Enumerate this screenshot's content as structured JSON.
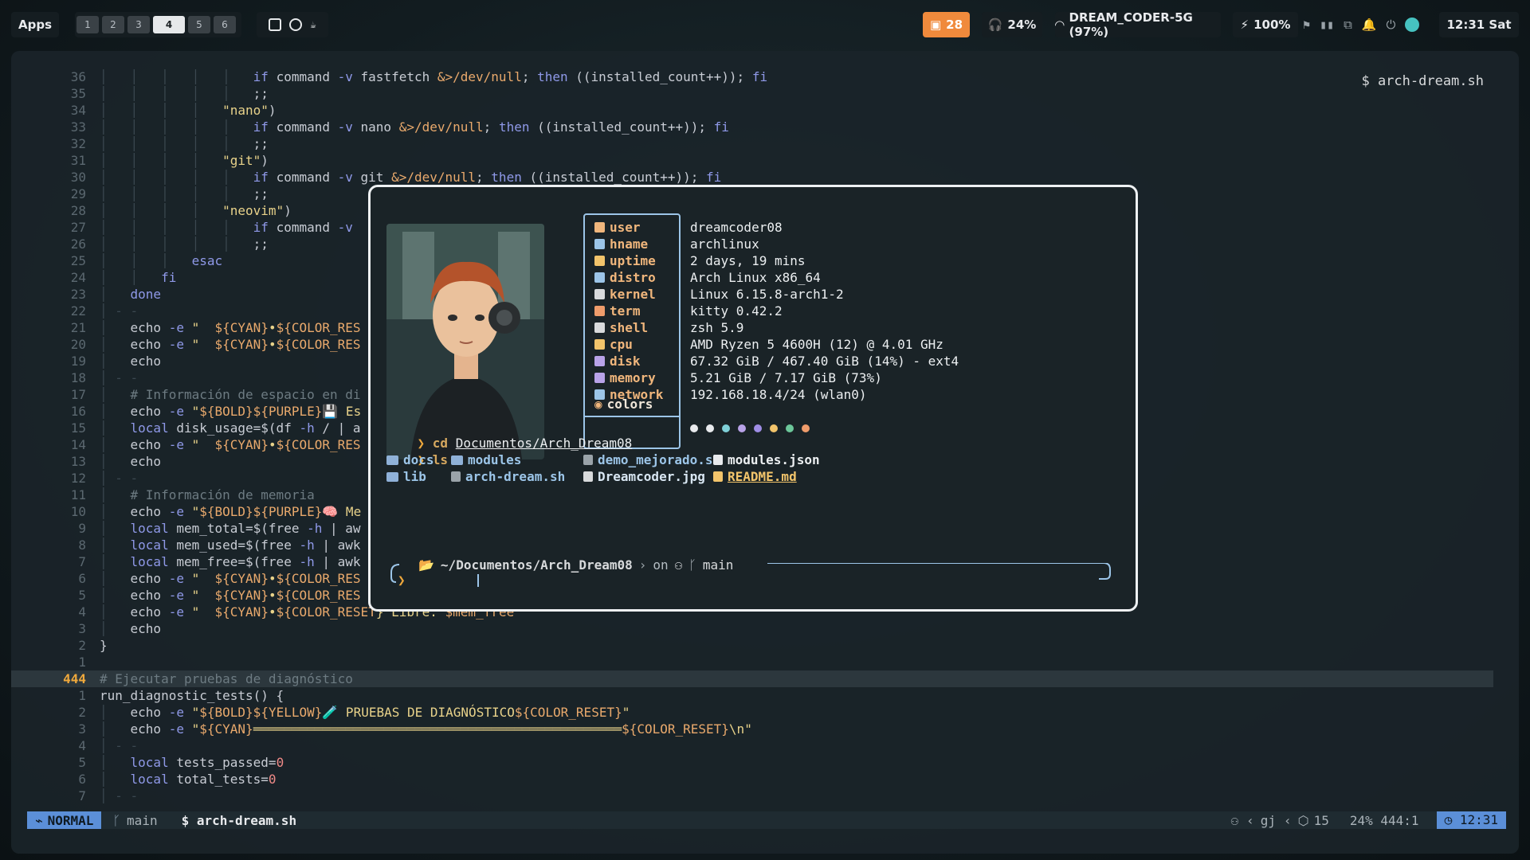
{
  "topbar": {
    "apps_label": "Apps",
    "workspaces": [
      "1",
      "2",
      "3",
      "4",
      "5",
      "6"
    ],
    "active_workspace": "4",
    "updates_count": "28",
    "audio": "24%",
    "wifi": "DREAM_CODER-5G (97%)",
    "battery": "100%",
    "clock": "12:31 Sat"
  },
  "editor": {
    "filename": "$ arch-dream.sh",
    "lines": [
      {
        "n": "36",
        "indent": "│   │   │   │   │   ",
        "parts": [
          [
            "kw",
            "if "
          ],
          [
            "cmd",
            "command "
          ],
          [
            "kw",
            "-v "
          ],
          [
            "cmd",
            "fastfetch "
          ],
          [
            "var",
            "&>/dev/null"
          ],
          [
            "cmd",
            "; "
          ],
          [
            "kw",
            "then "
          ],
          [
            "cmd",
            "((installed_count++)); "
          ],
          [
            "kw",
            "fi"
          ]
        ]
      },
      {
        "n": "35",
        "indent": "│   │   │   │   │   ",
        "parts": [
          [
            "cmd",
            ";;"
          ]
        ]
      },
      {
        "n": "34",
        "indent": "│   │   │   │   ",
        "parts": [
          [
            "str",
            "\"nano\""
          ],
          [
            "cmd",
            ")"
          ]
        ]
      },
      {
        "n": "33",
        "indent": "│   │   │   │   │   ",
        "parts": [
          [
            "kw",
            "if "
          ],
          [
            "cmd",
            "command "
          ],
          [
            "kw",
            "-v "
          ],
          [
            "cmd",
            "nano "
          ],
          [
            "var",
            "&>/dev/null"
          ],
          [
            "cmd",
            "; "
          ],
          [
            "kw",
            "then "
          ],
          [
            "cmd",
            "((installed_count++)); "
          ],
          [
            "kw",
            "fi"
          ]
        ]
      },
      {
        "n": "32",
        "indent": "│   │   │   │   │   ",
        "parts": [
          [
            "cmd",
            ";;"
          ]
        ]
      },
      {
        "n": "31",
        "indent": "│   │   │   │   ",
        "parts": [
          [
            "str",
            "\"git\""
          ],
          [
            "cmd",
            ")"
          ]
        ]
      },
      {
        "n": "30",
        "indent": "│   │   │   │   │   ",
        "parts": [
          [
            "kw",
            "if "
          ],
          [
            "cmd",
            "command "
          ],
          [
            "kw",
            "-v "
          ],
          [
            "cmd",
            "git "
          ],
          [
            "var",
            "&>/dev/null"
          ],
          [
            "cmd",
            "; "
          ],
          [
            "kw",
            "then "
          ],
          [
            "cmd",
            "((installed_count++)); "
          ],
          [
            "kw",
            "fi"
          ]
        ]
      },
      {
        "n": "29",
        "indent": "│   │   │   │   │   ",
        "parts": [
          [
            "cmd",
            ";;"
          ]
        ]
      },
      {
        "n": "28",
        "indent": "│   │   │   │   ",
        "parts": [
          [
            "str",
            "\"neovim\""
          ],
          [
            "cmd",
            ")"
          ]
        ]
      },
      {
        "n": "27",
        "indent": "│   │   │   │   │   ",
        "parts": [
          [
            "kw",
            "if "
          ],
          [
            "cmd",
            "command "
          ],
          [
            "kw",
            "-v"
          ]
        ]
      },
      {
        "n": "26",
        "indent": "│   │   │   │   │   ",
        "parts": [
          [
            "cmd",
            ";;"
          ]
        ]
      },
      {
        "n": "25",
        "indent": "│   │   │   ",
        "parts": [
          [
            "kw",
            "esac"
          ]
        ]
      },
      {
        "n": "24",
        "indent": "│   │   ",
        "parts": [
          [
            "kw",
            "fi"
          ]
        ]
      },
      {
        "n": "23",
        "indent": "│   ",
        "parts": [
          [
            "kw",
            "done"
          ]
        ]
      },
      {
        "n": "22",
        "indent": "│ - -",
        "parts": []
      },
      {
        "n": "21",
        "indent": "│   ",
        "parts": [
          [
            "cmd",
            "echo "
          ],
          [
            "kw",
            "-e "
          ],
          [
            "str",
            "\"  "
          ],
          [
            "var",
            "${CYAN}"
          ],
          [
            "str",
            "•"
          ],
          [
            "var",
            "${COLOR_RES"
          ]
        ]
      },
      {
        "n": "20",
        "indent": "│   ",
        "parts": [
          [
            "cmd",
            "echo "
          ],
          [
            "kw",
            "-e "
          ],
          [
            "str",
            "\"  "
          ],
          [
            "var",
            "${CYAN}"
          ],
          [
            "str",
            "•"
          ],
          [
            "var",
            "${COLOR_RES"
          ]
        ]
      },
      {
        "n": "19",
        "indent": "│   ",
        "parts": [
          [
            "cmd",
            "echo"
          ]
        ]
      },
      {
        "n": "18",
        "indent": "│ - -",
        "parts": []
      },
      {
        "n": "17",
        "indent": "│   ",
        "parts": [
          [
            "cmt",
            "# Información de espacio en di"
          ]
        ]
      },
      {
        "n": "16",
        "indent": "│   ",
        "parts": [
          [
            "cmd",
            "echo "
          ],
          [
            "kw",
            "-e "
          ],
          [
            "str",
            "\""
          ],
          [
            "var",
            "${BOLD}${PURPLE}"
          ],
          [
            "str",
            "💾 Es"
          ]
        ]
      },
      {
        "n": "15",
        "indent": "│   ",
        "parts": [
          [
            "kw",
            "local "
          ],
          [
            "cmd",
            "disk_usage=$(df "
          ],
          [
            "kw",
            "-h "
          ],
          [
            "cmd",
            "/ | a"
          ]
        ]
      },
      {
        "n": "14",
        "indent": "│   ",
        "parts": [
          [
            "cmd",
            "echo "
          ],
          [
            "kw",
            "-e "
          ],
          [
            "str",
            "\"  "
          ],
          [
            "var",
            "${CYAN}"
          ],
          [
            "str",
            "•"
          ],
          [
            "var",
            "${COLOR_RES"
          ]
        ]
      },
      {
        "n": "13",
        "indent": "│   ",
        "parts": [
          [
            "cmd",
            "echo"
          ]
        ]
      },
      {
        "n": "12",
        "indent": "│ - -",
        "parts": []
      },
      {
        "n": "11",
        "indent": "│   ",
        "parts": [
          [
            "cmt",
            "# Información de memoria"
          ]
        ]
      },
      {
        "n": "10",
        "indent": "│   ",
        "parts": [
          [
            "cmd",
            "echo "
          ],
          [
            "kw",
            "-e "
          ],
          [
            "str",
            "\""
          ],
          [
            "var",
            "${BOLD}${PURPLE}"
          ],
          [
            "str",
            "🧠 Me"
          ]
        ]
      },
      {
        "n": "9",
        "indent": "│   ",
        "parts": [
          [
            "kw",
            "local "
          ],
          [
            "cmd",
            "mem_total=$(free "
          ],
          [
            "kw",
            "-h "
          ],
          [
            "cmd",
            "| aw"
          ]
        ]
      },
      {
        "n": "8",
        "indent": "│   ",
        "parts": [
          [
            "kw",
            "local "
          ],
          [
            "cmd",
            "mem_used=$(free "
          ],
          [
            "kw",
            "-h "
          ],
          [
            "cmd",
            "| awk"
          ]
        ]
      },
      {
        "n": "7",
        "indent": "│   ",
        "parts": [
          [
            "kw",
            "local "
          ],
          [
            "cmd",
            "mem_free=$(free "
          ],
          [
            "kw",
            "-h "
          ],
          [
            "cmd",
            "| awk"
          ]
        ]
      },
      {
        "n": "6",
        "indent": "│   ",
        "parts": [
          [
            "cmd",
            "echo "
          ],
          [
            "kw",
            "-e "
          ],
          [
            "str",
            "\"  "
          ],
          [
            "var",
            "${CYAN}"
          ],
          [
            "str",
            "•"
          ],
          [
            "var",
            "${COLOR_RES"
          ]
        ]
      },
      {
        "n": "5",
        "indent": "│   ",
        "parts": [
          [
            "cmd",
            "echo "
          ],
          [
            "kw",
            "-e "
          ],
          [
            "str",
            "\"  "
          ],
          [
            "var",
            "${CYAN}"
          ],
          [
            "str",
            "•"
          ],
          [
            "var",
            "${COLOR_RES"
          ]
        ]
      },
      {
        "n": "4",
        "indent": "│   ",
        "parts": [
          [
            "cmd",
            "echo "
          ],
          [
            "kw",
            "-e "
          ],
          [
            "str",
            "\"  "
          ],
          [
            "var",
            "${CYAN}"
          ],
          [
            "str",
            "•"
          ],
          [
            "var",
            "${COLOR_RESET"
          ],
          [
            "str",
            "} Libre: "
          ],
          [
            "var",
            "$mem_free"
          ],
          [
            "str",
            "\""
          ]
        ]
      },
      {
        "n": "3",
        "indent": "│   ",
        "parts": [
          [
            "cmd",
            "echo"
          ]
        ]
      },
      {
        "n": "2",
        "indent": "",
        "parts": [
          [
            "cmd",
            "}"
          ]
        ]
      },
      {
        "n": "1",
        "indent": "",
        "parts": []
      },
      {
        "n": "444",
        "indent": "",
        "parts": [
          [
            "cmt",
            "# Ejecutar pruebas de diagnóstico"
          ]
        ],
        "current": true
      },
      {
        "n": "1",
        "indent": "",
        "parts": [
          [
            "cmd",
            "run_diagnostic_tests() {"
          ]
        ]
      },
      {
        "n": "2",
        "indent": "│   ",
        "parts": [
          [
            "cmd",
            "echo "
          ],
          [
            "kw",
            "-e "
          ],
          [
            "str",
            "\""
          ],
          [
            "var",
            "${BOLD}${YELLOW}"
          ],
          [
            "str",
            "🧪 PRUEBAS DE DIAGNÓSTICO"
          ],
          [
            "var",
            "${COLOR_RESET}"
          ],
          [
            "str",
            "\""
          ]
        ]
      },
      {
        "n": "3",
        "indent": "│   ",
        "parts": [
          [
            "cmd",
            "echo "
          ],
          [
            "kw",
            "-e "
          ],
          [
            "str",
            "\""
          ],
          [
            "var",
            "${CYAN}"
          ],
          [
            "str",
            "════════════════════════════════════════════════"
          ],
          [
            "var",
            "${COLOR_RESET}"
          ],
          [
            "str",
            "\\n\""
          ]
        ]
      },
      {
        "n": "4",
        "indent": "│ - -",
        "parts": []
      },
      {
        "n": "5",
        "indent": "│   ",
        "parts": [
          [
            "kw",
            "local "
          ],
          [
            "cmd",
            "tests_passed="
          ],
          [
            "num",
            "0"
          ]
        ]
      },
      {
        "n": "6",
        "indent": "│   ",
        "parts": [
          [
            "kw",
            "local "
          ],
          [
            "cmd",
            "total_tests="
          ],
          [
            "num",
            "0"
          ]
        ]
      },
      {
        "n": "7",
        "indent": "│ - -",
        "parts": []
      }
    ]
  },
  "statusline": {
    "mode": "NORMAL",
    "branch": "main",
    "file": "$  arch-dream.sh",
    "extras": "gj",
    "count": "15",
    "position": "24% 444:1",
    "time": "12:31"
  },
  "terminal": {
    "info_keys": [
      "user",
      "hname",
      "uptime",
      "distro",
      "kernel",
      "term",
      "shell",
      "cpu",
      "disk",
      "memory",
      "network"
    ],
    "info_values": [
      "dreamcoder08",
      "archlinux",
      "2 days, 19 mins",
      "Arch Linux x86_64",
      "Linux 6.15.8-arch1-2",
      "kitty 0.42.2",
      "zsh 5.9",
      "AMD Ryzen 5 4600H (12) @ 4.01 GHz",
      "67.32 GiB / 467.40 GiB (14%) - ext4",
      "5.21 GiB / 7.17 GiB (73%)",
      "192.168.18.4/24 (wlan0)"
    ],
    "colors_label": "colors",
    "palette": [
      "#e8eaed",
      "#e8eaed",
      "#7fd0d8",
      "#b8a2e8",
      "#9f8ee6",
      "#f2c46b",
      "#6cc79a",
      "#ef9c6b"
    ],
    "cmd1": "cd",
    "cmd1_arg": "Documentos/Arch_Dream08",
    "cmd2": "ls",
    "ls_items": [
      {
        "name": "docs",
        "kind": "folder"
      },
      {
        "name": "modules",
        "kind": "folder"
      },
      {
        "name": "demo_mejorado.sh",
        "kind": "script"
      },
      {
        "name": "modules.json",
        "kind": "json"
      },
      {
        "name": "lib",
        "kind": "folder"
      },
      {
        "name": "arch-dream.sh",
        "kind": "script"
      },
      {
        "name": "Dreamcoder.jpg",
        "kind": "image"
      },
      {
        "name": "README.md",
        "kind": "readme"
      }
    ],
    "prompt_path": "~/Documentos/Arch_Dream08",
    "prompt_on": "on",
    "prompt_branch": "main"
  },
  "colors": {
    "accent_orange": "#f0a93c",
    "accent_blue": "#9cc5e8",
    "updates_bg": "#f08a3c"
  }
}
